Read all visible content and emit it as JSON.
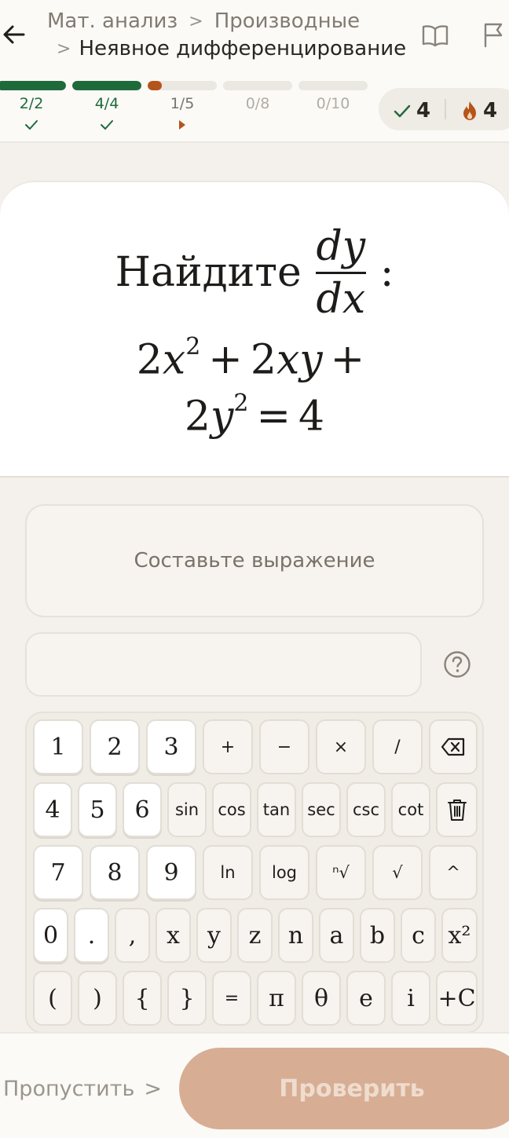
{
  "header": {
    "breadcrumb": [
      "Мат. анализ",
      "Производные",
      "Неявное дифференцирование"
    ]
  },
  "progress": [
    {
      "label": "2/2",
      "fill": 1.0,
      "state": "done"
    },
    {
      "label": "4/4",
      "fill": 1.0,
      "state": "done"
    },
    {
      "label": "1/5",
      "fill": 0.2,
      "state": "current"
    },
    {
      "label": "0/8",
      "fill": 0.0,
      "state": "locked"
    },
    {
      "label": "0/10",
      "fill": 0.0,
      "state": "locked"
    }
  ],
  "stats": {
    "correct": "4",
    "streak": "4"
  },
  "question": {
    "prompt": "Найдите",
    "frac_num": "dy",
    "frac_den": "dx",
    "colon": ":"
  },
  "compose_label": "Составьте выражение",
  "keypad": {
    "rows": [
      [
        "1",
        "2",
        "3",
        "+",
        "−",
        "×",
        "/",
        "⌫"
      ],
      [
        "4",
        "5",
        "6",
        "sin",
        "cos",
        "tan",
        "sec",
        "csc",
        "cot",
        "🗑"
      ],
      [
        "7",
        "8",
        "9",
        "ln",
        "log",
        "ⁿ√",
        "√",
        "^"
      ],
      [
        "0",
        ".",
        ",",
        "x",
        "y",
        "z",
        "n",
        "a",
        "b",
        "c",
        "x²"
      ],
      [
        "(",
        ")",
        "{",
        "}",
        "=",
        "π",
        "θ",
        "e",
        "i",
        "+C"
      ]
    ]
  },
  "footer": {
    "skip_label": "Пропустить",
    "check_label": "Проверить"
  },
  "colors": {
    "done": "#1f6a3b",
    "current": "#b5541a",
    "locked": "#ebe7e1",
    "check_button": "#d7ae94"
  }
}
